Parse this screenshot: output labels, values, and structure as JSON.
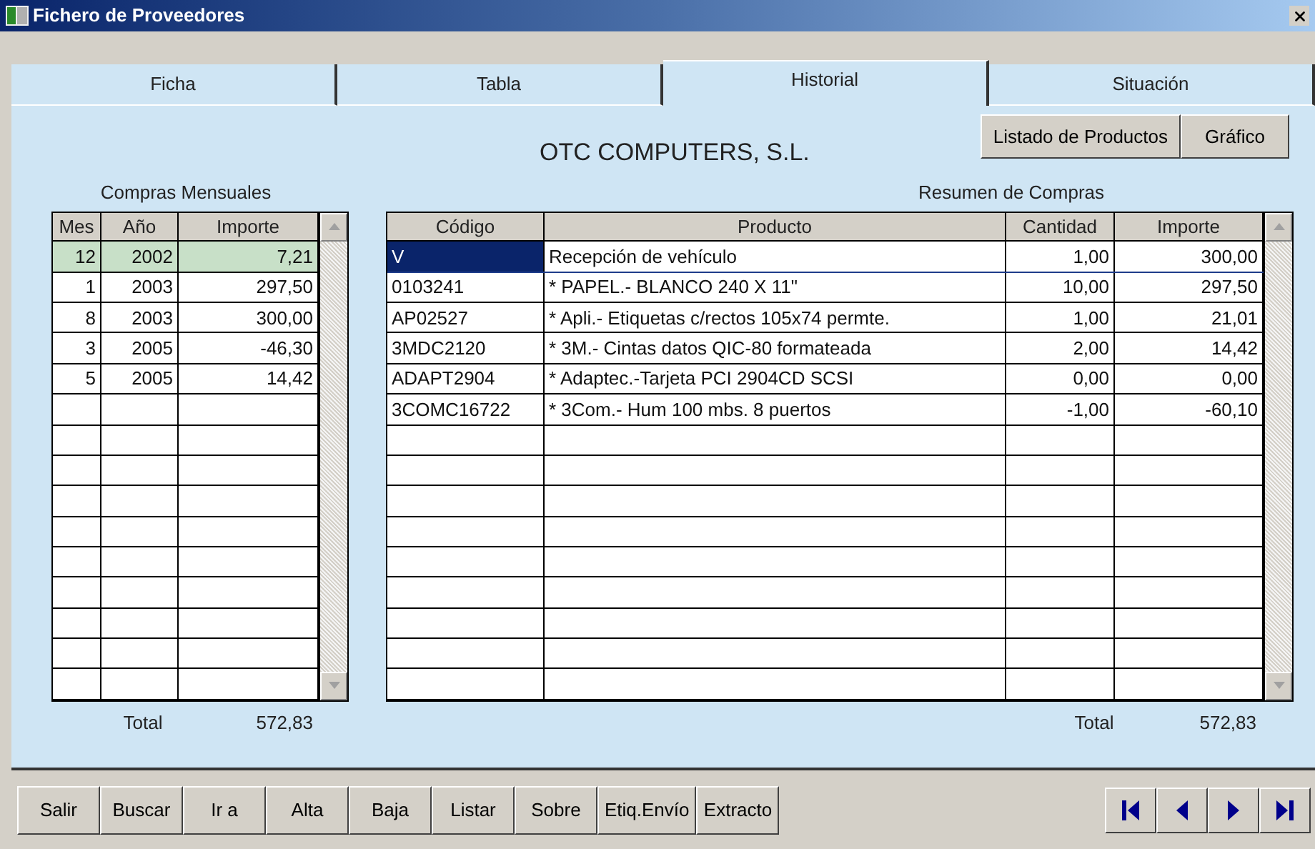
{
  "window": {
    "title": "Fichero de Proveedores"
  },
  "tabs": [
    {
      "label": "Ficha",
      "selected": false
    },
    {
      "label": "Tabla",
      "selected": false
    },
    {
      "label": "Historial",
      "selected": true
    },
    {
      "label": "Situación",
      "selected": false
    }
  ],
  "company": "OTC COMPUTERS, S.L.",
  "header_buttons": [
    "Listado de Productos",
    "Gráfico"
  ],
  "monthly": {
    "title": "Compras Mensuales",
    "columns": [
      "Mes",
      "Año",
      "Importe"
    ],
    "rows": [
      {
        "cells": [
          "12",
          "2002",
          "7,21"
        ],
        "selected": true
      },
      {
        "cells": [
          "1",
          "2003",
          "297,50"
        ],
        "selected": false
      },
      {
        "cells": [
          "8",
          "2003",
          "300,00"
        ],
        "selected": false
      },
      {
        "cells": [
          "3",
          "2005",
          "-46,30"
        ],
        "selected": false
      },
      {
        "cells": [
          "5",
          "2005",
          "14,42"
        ],
        "selected": false
      }
    ],
    "total_label": "Total",
    "total": "572,83"
  },
  "summary": {
    "title": "Resumen de Compras",
    "columns": [
      "Código",
      "Producto",
      "Cantidad",
      "Importe"
    ],
    "rows": [
      {
        "cells": [
          "V",
          "Recepción de vehículo",
          "1,00",
          "300,00"
        ],
        "selected": true
      },
      {
        "cells": [
          "0103241",
          "* PAPEL.- BLANCO 240 X 11\"",
          "10,00",
          "297,50"
        ],
        "selected": false
      },
      {
        "cells": [
          "AP02527",
          "* Apli.- Etiquetas c/rectos 105x74 permte.",
          "1,00",
          "21,01"
        ],
        "selected": false
      },
      {
        "cells": [
          "3MDC2120",
          "* 3M.- Cintas datos QIC-80 formateada",
          "2,00",
          "14,42"
        ],
        "selected": false
      },
      {
        "cells": [
          "ADAPT2904",
          "* Adaptec.-Tarjeta PCI 2904CD SCSI",
          "0,00",
          "0,00"
        ],
        "selected": false
      },
      {
        "cells": [
          "3COMC16722",
          "* 3Com.- Hum 100 mbs. 8 puertos",
          "-1,00",
          "-60,10"
        ],
        "selected": false
      }
    ],
    "total_label": "Total",
    "total": "572,83"
  },
  "toolbar": [
    "Salir",
    "Buscar",
    "Ir a",
    "Alta",
    "Baja",
    "Listar",
    "Sobre",
    "Etiq.Envío",
    "Extracto"
  ]
}
